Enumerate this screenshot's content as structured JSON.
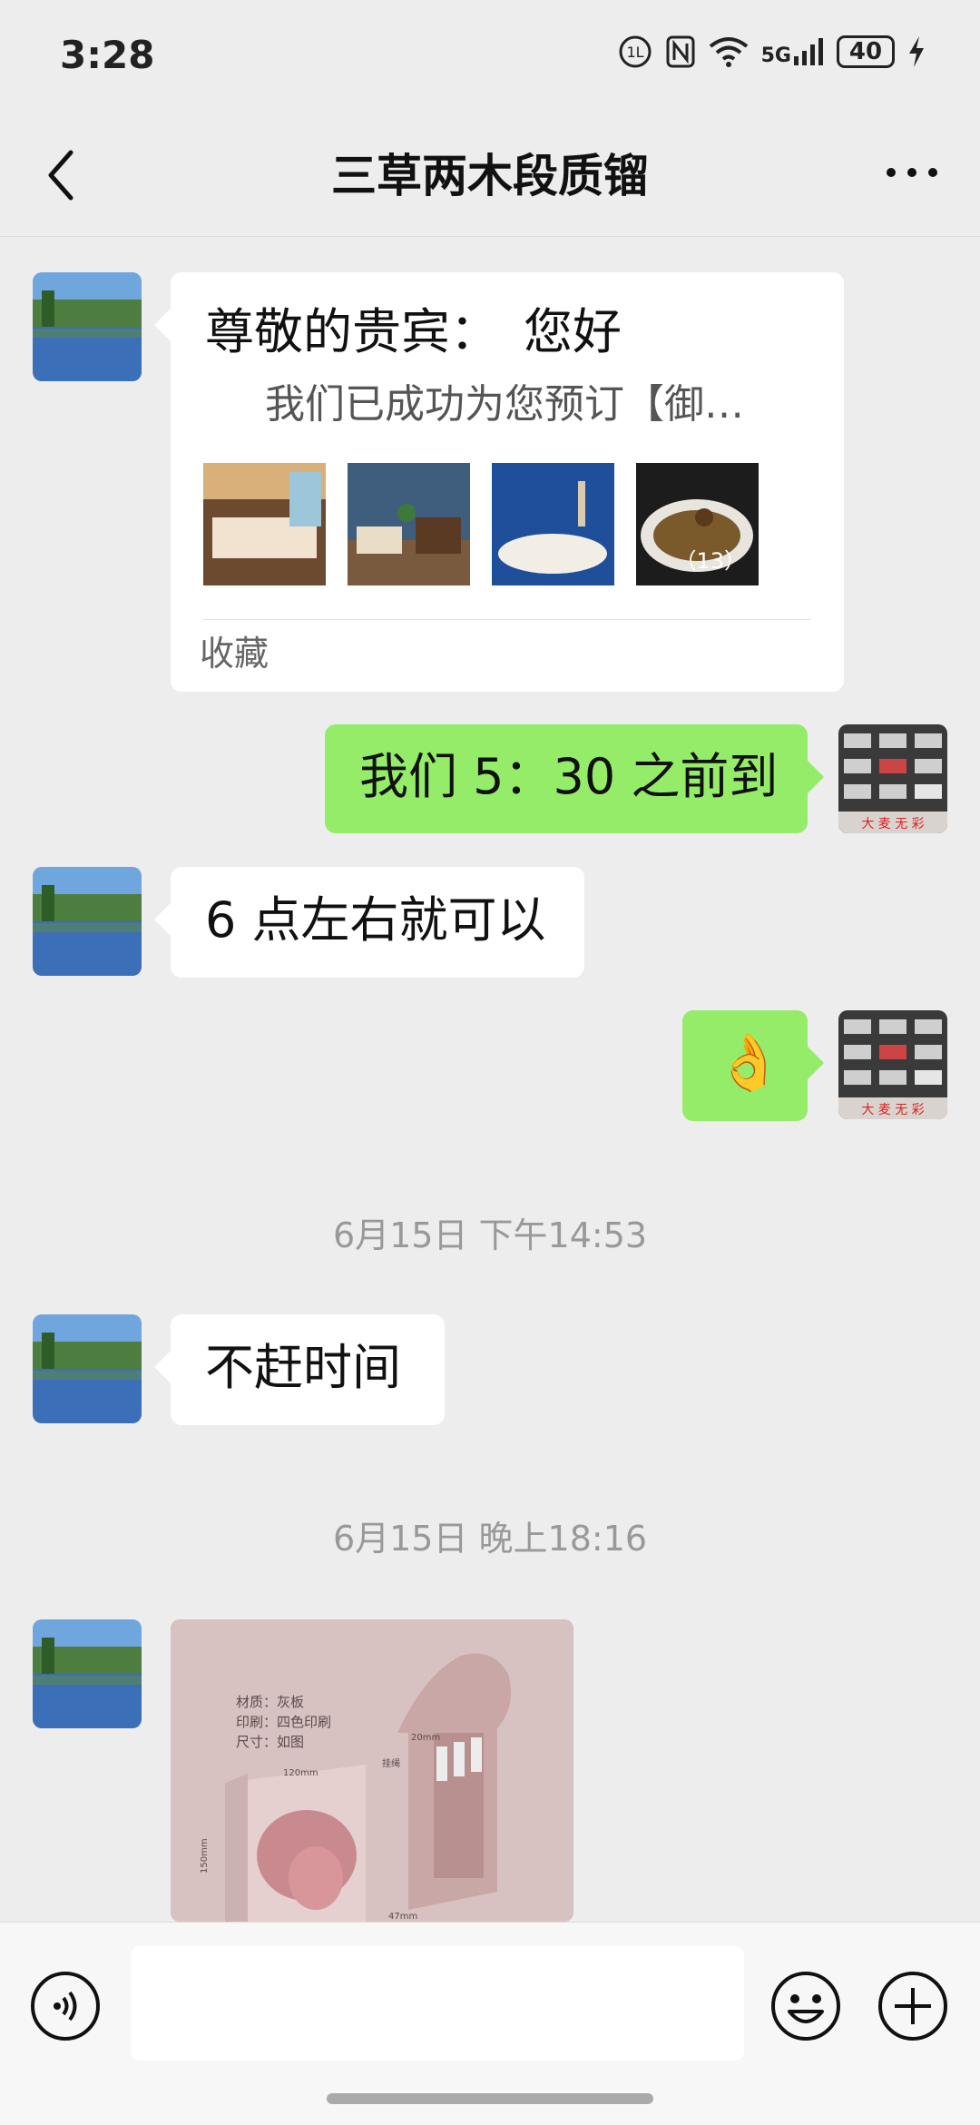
{
  "status_bar": {
    "time": "3:28",
    "battery": "40",
    "network": "5G"
  },
  "header": {
    "title": "三草两木段质镏"
  },
  "messages": [
    {
      "side": "left",
      "type": "card",
      "title": "尊敬的贵宾：　您好",
      "subtitle": "我们已成功为您预订【御…",
      "image_count": "（13）",
      "footer": "收藏"
    },
    {
      "side": "right",
      "type": "text",
      "text": "我们 5：30 之前到"
    },
    {
      "side": "left",
      "type": "text",
      "text": "6 点左右就可以"
    },
    {
      "side": "right",
      "type": "emoji",
      "emoji": "👌"
    },
    {
      "type": "timestamp",
      "text": "6月15日 下午14:53"
    },
    {
      "side": "left",
      "type": "text",
      "text": "不赶时间"
    },
    {
      "type": "timestamp",
      "text": "6月15日 晚上18:16"
    },
    {
      "side": "left",
      "type": "image",
      "image_labels": {
        "material": "材质：灰板",
        "print": "印刷：四色印刷",
        "size": "尺寸：如图",
        "dim_width": "120mm",
        "dim_height": "150mm",
        "dim_depth": "47mm",
        "dim_top": "20mm",
        "handle": "挂绳"
      }
    }
  ],
  "input_bar": {
    "placeholder": ""
  },
  "colors": {
    "green_bubble": "#95ec69",
    "background": "#ededed"
  }
}
